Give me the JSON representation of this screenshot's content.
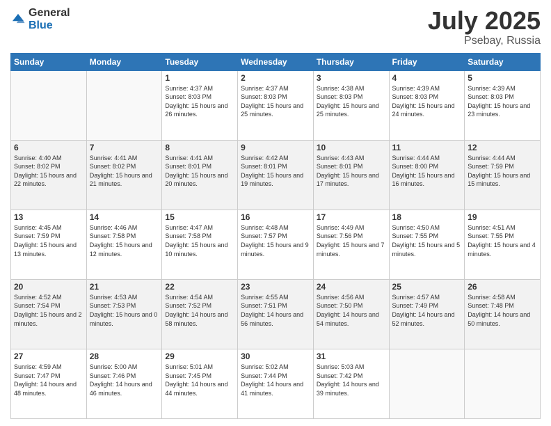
{
  "logo": {
    "general": "General",
    "blue": "Blue"
  },
  "title": {
    "month_year": "July 2025",
    "location": "Psebay, Russia"
  },
  "weekdays": [
    "Sunday",
    "Monday",
    "Tuesday",
    "Wednesday",
    "Thursday",
    "Friday",
    "Saturday"
  ],
  "weeks": [
    [
      {
        "day": "",
        "sunrise": "",
        "sunset": "",
        "daylight": ""
      },
      {
        "day": "",
        "sunrise": "",
        "sunset": "",
        "daylight": ""
      },
      {
        "day": "1",
        "sunrise": "Sunrise: 4:37 AM",
        "sunset": "Sunset: 8:03 PM",
        "daylight": "Daylight: 15 hours and 26 minutes."
      },
      {
        "day": "2",
        "sunrise": "Sunrise: 4:37 AM",
        "sunset": "Sunset: 8:03 PM",
        "daylight": "Daylight: 15 hours and 25 minutes."
      },
      {
        "day": "3",
        "sunrise": "Sunrise: 4:38 AM",
        "sunset": "Sunset: 8:03 PM",
        "daylight": "Daylight: 15 hours and 25 minutes."
      },
      {
        "day": "4",
        "sunrise": "Sunrise: 4:39 AM",
        "sunset": "Sunset: 8:03 PM",
        "daylight": "Daylight: 15 hours and 24 minutes."
      },
      {
        "day": "5",
        "sunrise": "Sunrise: 4:39 AM",
        "sunset": "Sunset: 8:03 PM",
        "daylight": "Daylight: 15 hours and 23 minutes."
      }
    ],
    [
      {
        "day": "6",
        "sunrise": "Sunrise: 4:40 AM",
        "sunset": "Sunset: 8:02 PM",
        "daylight": "Daylight: 15 hours and 22 minutes."
      },
      {
        "day": "7",
        "sunrise": "Sunrise: 4:41 AM",
        "sunset": "Sunset: 8:02 PM",
        "daylight": "Daylight: 15 hours and 21 minutes."
      },
      {
        "day": "8",
        "sunrise": "Sunrise: 4:41 AM",
        "sunset": "Sunset: 8:01 PM",
        "daylight": "Daylight: 15 hours and 20 minutes."
      },
      {
        "day": "9",
        "sunrise": "Sunrise: 4:42 AM",
        "sunset": "Sunset: 8:01 PM",
        "daylight": "Daylight: 15 hours and 19 minutes."
      },
      {
        "day": "10",
        "sunrise": "Sunrise: 4:43 AM",
        "sunset": "Sunset: 8:01 PM",
        "daylight": "Daylight: 15 hours and 17 minutes."
      },
      {
        "day": "11",
        "sunrise": "Sunrise: 4:44 AM",
        "sunset": "Sunset: 8:00 PM",
        "daylight": "Daylight: 15 hours and 16 minutes."
      },
      {
        "day": "12",
        "sunrise": "Sunrise: 4:44 AM",
        "sunset": "Sunset: 7:59 PM",
        "daylight": "Daylight: 15 hours and 15 minutes."
      }
    ],
    [
      {
        "day": "13",
        "sunrise": "Sunrise: 4:45 AM",
        "sunset": "Sunset: 7:59 PM",
        "daylight": "Daylight: 15 hours and 13 minutes."
      },
      {
        "day": "14",
        "sunrise": "Sunrise: 4:46 AM",
        "sunset": "Sunset: 7:58 PM",
        "daylight": "Daylight: 15 hours and 12 minutes."
      },
      {
        "day": "15",
        "sunrise": "Sunrise: 4:47 AM",
        "sunset": "Sunset: 7:58 PM",
        "daylight": "Daylight: 15 hours and 10 minutes."
      },
      {
        "day": "16",
        "sunrise": "Sunrise: 4:48 AM",
        "sunset": "Sunset: 7:57 PM",
        "daylight": "Daylight: 15 hours and 9 minutes."
      },
      {
        "day": "17",
        "sunrise": "Sunrise: 4:49 AM",
        "sunset": "Sunset: 7:56 PM",
        "daylight": "Daylight: 15 hours and 7 minutes."
      },
      {
        "day": "18",
        "sunrise": "Sunrise: 4:50 AM",
        "sunset": "Sunset: 7:55 PM",
        "daylight": "Daylight: 15 hours and 5 minutes."
      },
      {
        "day": "19",
        "sunrise": "Sunrise: 4:51 AM",
        "sunset": "Sunset: 7:55 PM",
        "daylight": "Daylight: 15 hours and 4 minutes."
      }
    ],
    [
      {
        "day": "20",
        "sunrise": "Sunrise: 4:52 AM",
        "sunset": "Sunset: 7:54 PM",
        "daylight": "Daylight: 15 hours and 2 minutes."
      },
      {
        "day": "21",
        "sunrise": "Sunrise: 4:53 AM",
        "sunset": "Sunset: 7:53 PM",
        "daylight": "Daylight: 15 hours and 0 minutes."
      },
      {
        "day": "22",
        "sunrise": "Sunrise: 4:54 AM",
        "sunset": "Sunset: 7:52 PM",
        "daylight": "Daylight: 14 hours and 58 minutes."
      },
      {
        "day": "23",
        "sunrise": "Sunrise: 4:55 AM",
        "sunset": "Sunset: 7:51 PM",
        "daylight": "Daylight: 14 hours and 56 minutes."
      },
      {
        "day": "24",
        "sunrise": "Sunrise: 4:56 AM",
        "sunset": "Sunset: 7:50 PM",
        "daylight": "Daylight: 14 hours and 54 minutes."
      },
      {
        "day": "25",
        "sunrise": "Sunrise: 4:57 AM",
        "sunset": "Sunset: 7:49 PM",
        "daylight": "Daylight: 14 hours and 52 minutes."
      },
      {
        "day": "26",
        "sunrise": "Sunrise: 4:58 AM",
        "sunset": "Sunset: 7:48 PM",
        "daylight": "Daylight: 14 hours and 50 minutes."
      }
    ],
    [
      {
        "day": "27",
        "sunrise": "Sunrise: 4:59 AM",
        "sunset": "Sunset: 7:47 PM",
        "daylight": "Daylight: 14 hours and 48 minutes."
      },
      {
        "day": "28",
        "sunrise": "Sunrise: 5:00 AM",
        "sunset": "Sunset: 7:46 PM",
        "daylight": "Daylight: 14 hours and 46 minutes."
      },
      {
        "day": "29",
        "sunrise": "Sunrise: 5:01 AM",
        "sunset": "Sunset: 7:45 PM",
        "daylight": "Daylight: 14 hours and 44 minutes."
      },
      {
        "day": "30",
        "sunrise": "Sunrise: 5:02 AM",
        "sunset": "Sunset: 7:44 PM",
        "daylight": "Daylight: 14 hours and 41 minutes."
      },
      {
        "day": "31",
        "sunrise": "Sunrise: 5:03 AM",
        "sunset": "Sunset: 7:42 PM",
        "daylight": "Daylight: 14 hours and 39 minutes."
      },
      {
        "day": "",
        "sunrise": "",
        "sunset": "",
        "daylight": ""
      },
      {
        "day": "",
        "sunrise": "",
        "sunset": "",
        "daylight": ""
      }
    ]
  ]
}
